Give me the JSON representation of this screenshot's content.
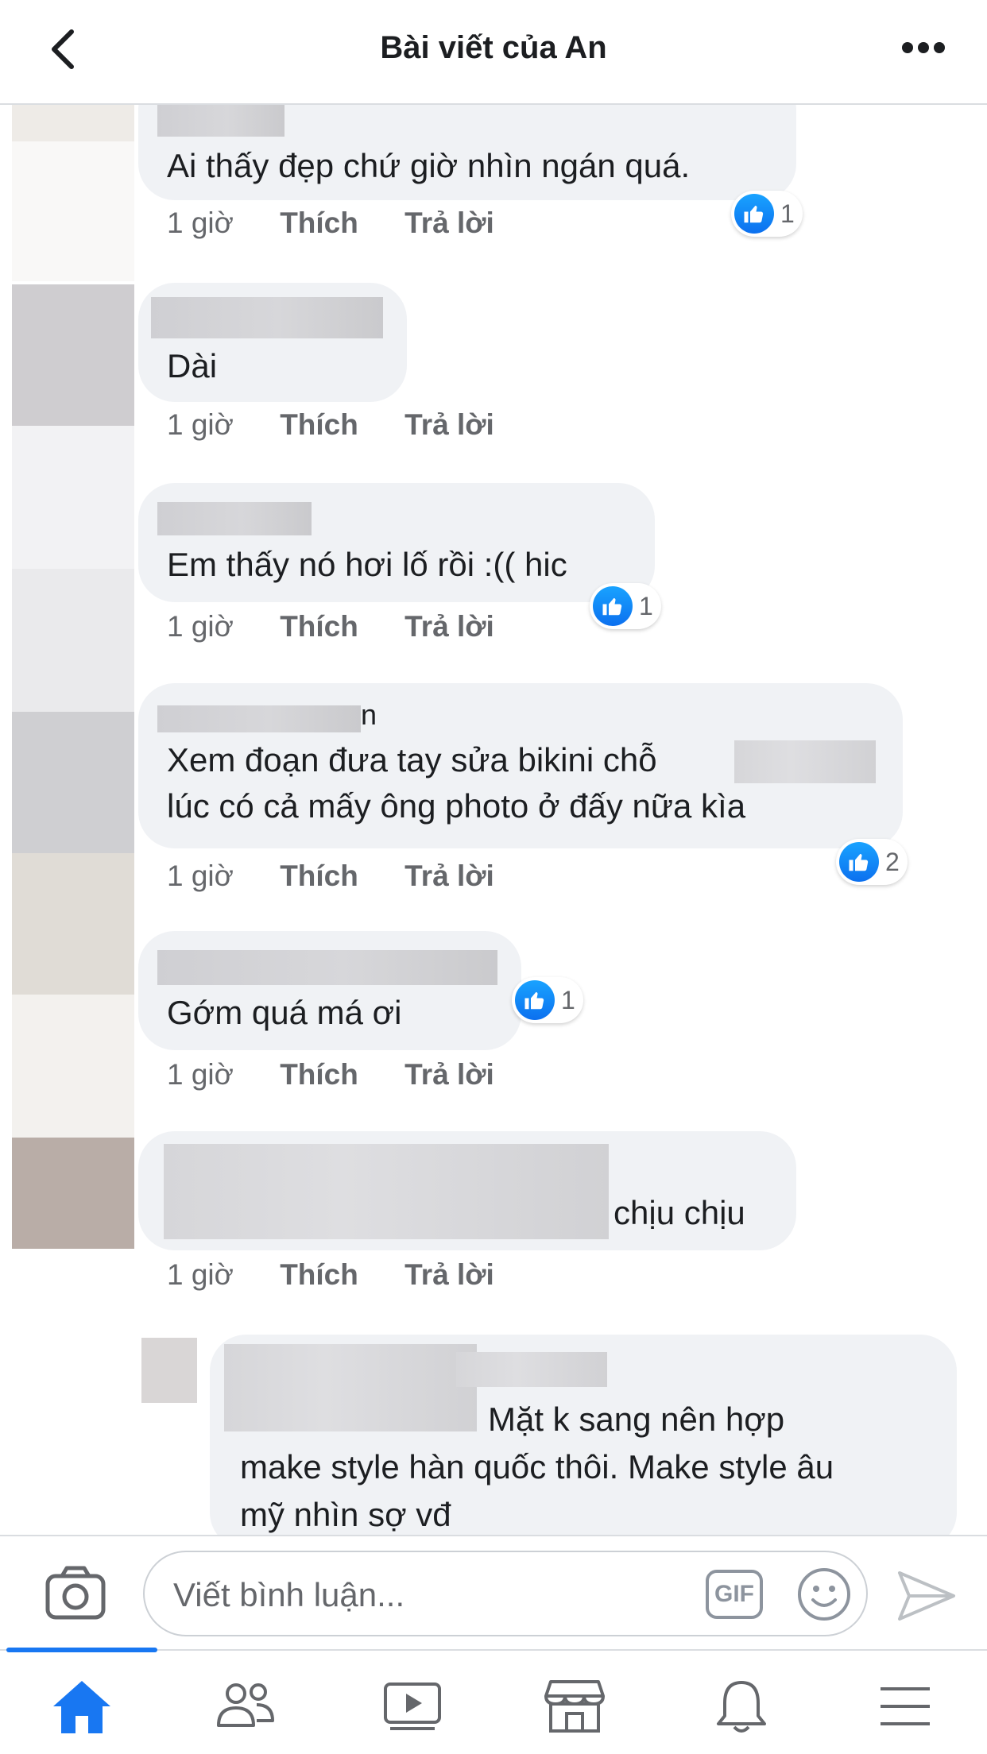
{
  "header": {
    "title": "Bài viết của An"
  },
  "comments": [
    {
      "text": "Ai thấy đẹp chứ giờ nhìn ngán quá.",
      "time": "1 giờ",
      "like_label": "Thích",
      "reply_label": "Trả lời",
      "reactions": "1"
    },
    {
      "text": "Dài",
      "time": "1 giờ",
      "like_label": "Thích",
      "reply_label": "Trả lời"
    },
    {
      "text": "Em thấy nó hơi lố rồi :(( hic",
      "time": "1 giờ",
      "like_label": "Thích",
      "reply_label": "Trả lời",
      "reactions": "1"
    },
    {
      "line1": "Xem đoạn đưa tay sửa bikini chỗ",
      "line2": "lúc có cả mấy ông photo ở đấy nữa kìa",
      "name_tail": "n",
      "time": "1 giờ",
      "like_label": "Thích",
      "reply_label": "Trả lời",
      "reactions": "2"
    },
    {
      "text": "Gớm quá má ơi",
      "time": "1 giờ",
      "like_label": "Thích",
      "reply_label": "Trả lời",
      "reactions": "1"
    },
    {
      "text": "chịu chịu",
      "time": "1 giờ",
      "like_label": "Thích",
      "reply_label": "Trả lời"
    },
    {
      "line1": "Mặt k sang nên hợp",
      "line2": "make style hàn quốc thôi. Make style âu",
      "line3": "mỹ nhìn sợ vđ"
    }
  ],
  "composer": {
    "placeholder": "Viết bình luận...",
    "gif_label": "GIF"
  },
  "icons": {
    "back": "chevron-left-icon",
    "more": "more-horizontal-icon",
    "camera": "camera-icon",
    "emoji": "emoji-icon",
    "send": "send-icon",
    "like": "thumbs-up-icon",
    "tabs": [
      "home-icon",
      "friends-icon",
      "watch-icon",
      "marketplace-icon",
      "notifications-icon",
      "menu-icon"
    ]
  },
  "colors": {
    "accent": "#1877f2",
    "bubble": "#f0f2f5",
    "meta_text": "#65676b",
    "icon_gray": "#65676b"
  }
}
